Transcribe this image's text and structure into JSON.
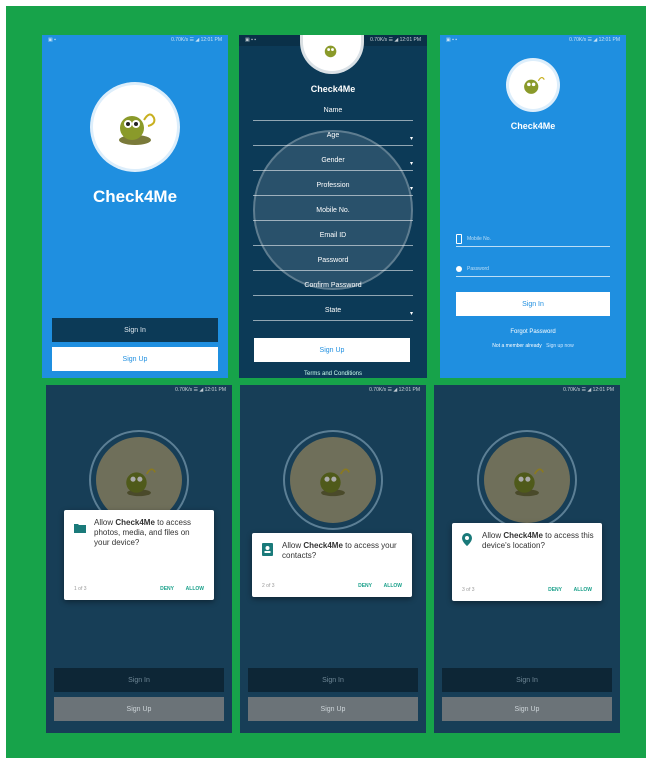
{
  "app_name": "Check4Me",
  "colors": {
    "blue": "#1f8fe0",
    "navy": "#0c3a57",
    "dark": "#173e57",
    "frame_green": "#17a34a",
    "accent": "#1aa08a"
  },
  "screens": {
    "welcome": {
      "status": "0.70K/s ☰ ◢ 12:01 PM",
      "buttons": {
        "sign_in": "Sign In",
        "sign_up": "Sign Up"
      }
    },
    "register": {
      "status": "0.70K/s ☰ ◢ 12:01 PM",
      "fields": [
        "Name",
        "Age",
        "Gender",
        "Profession",
        "Mobile No.",
        "Email ID",
        "Password",
        "Confirm Password",
        "State"
      ],
      "sign_up": "Sign Up",
      "terms": "Terms and Conditions"
    },
    "login": {
      "status": "0.70K/s ☰ ◢ 12:01 PM",
      "mobile_placeholder": "Mobile No.",
      "password_placeholder": "Password",
      "sign_in": "Sign In",
      "forgot": "Forgot Password",
      "new_user": "Not a member already",
      "signup_link": "Sign up now"
    },
    "perm1": {
      "prefix": "Allow ",
      "app": "Check4Me",
      "suffix": " to access photos, media, and files on your device?",
      "counter": "1 of 3",
      "deny": "DENY",
      "allow": "ALLOW",
      "icon": "folder-icon"
    },
    "perm2": {
      "prefix": "Allow ",
      "app": "Check4Me",
      "suffix": " to access your contacts?",
      "counter": "2 of 3",
      "deny": "DENY",
      "allow": "ALLOW",
      "icon": "contacts-icon"
    },
    "perm3": {
      "prefix": "Allow ",
      "app": "Check4Me",
      "suffix": " to access this device's location?",
      "counter": "3 of 3",
      "deny": "DENY",
      "allow": "ALLOW",
      "icon": "location-pin-icon"
    },
    "perm_buttons": {
      "sign_in": "Sign In",
      "sign_up": "Sign Up"
    }
  }
}
